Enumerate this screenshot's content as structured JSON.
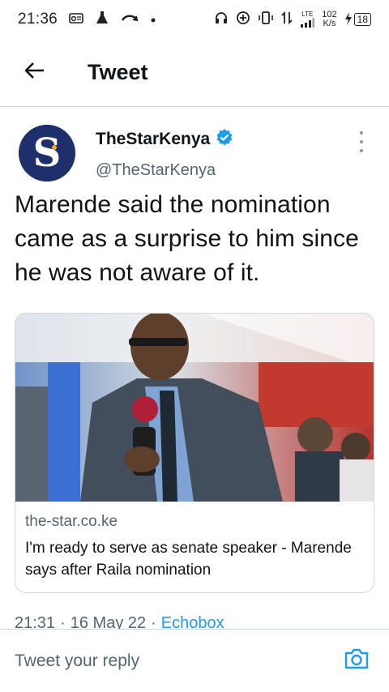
{
  "status_bar": {
    "time": "21:36",
    "lte_label": "LTE",
    "net_speed_value": "102",
    "net_speed_unit": "K/s",
    "battery_level": "18"
  },
  "header": {
    "title": "Tweet"
  },
  "tweet": {
    "display_name": "TheStarKenya",
    "handle": "@TheStarKenya",
    "verified": true,
    "avatar_letter": "S",
    "text": "Marende said the nomination came as a surprise to him since he was not aware of it.",
    "card": {
      "domain": "the-star.co.ke",
      "title": "I'm ready to serve as senate speaker - Marende says after Raila nomination"
    },
    "time": "21:31",
    "date": "16 May 22",
    "separator": "·",
    "source": "Echobox"
  },
  "reply": {
    "placeholder": "Tweet your reply"
  },
  "colors": {
    "accent": "#1d9bf0",
    "avatar_bg": "#1e2f6b",
    "secondary_text": "#536471"
  }
}
